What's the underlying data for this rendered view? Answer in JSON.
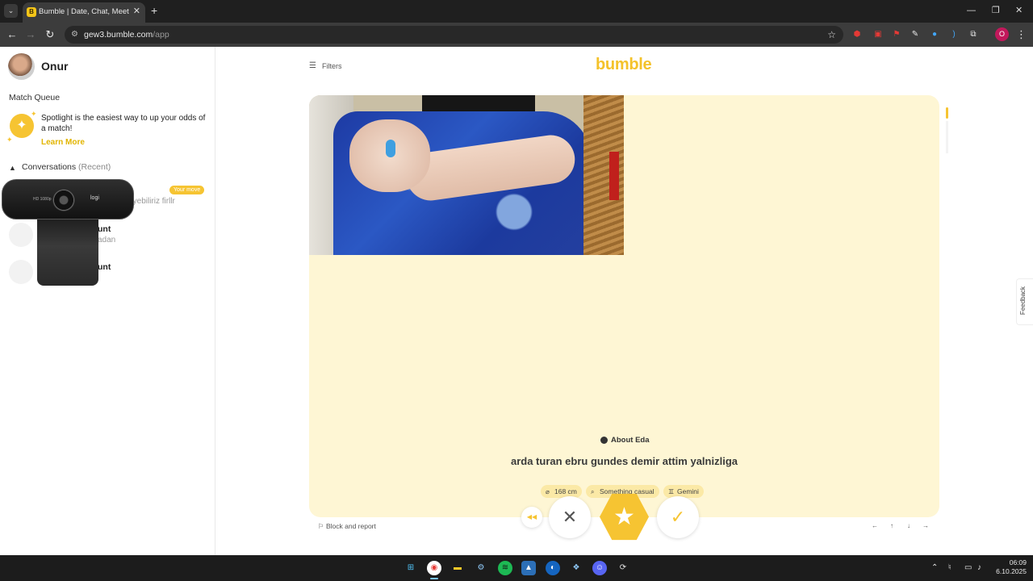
{
  "browser": {
    "tab_title": "Bumble | Date, Chat, Meet New",
    "tab_favicon": "B",
    "url_host": "gew3.bumble.com",
    "url_path": "/app",
    "profile_initial": "O"
  },
  "sidebar": {
    "user_name": "Onur",
    "match_queue_title": "Match Queue",
    "spotlight_text": "Spotlight is the easiest way to up your odds of a match!",
    "learn_more": "Learn More",
    "conversations_title": "Conversations",
    "conversations_filter": "(Recent)",
    "conversations": [
      {
        "badge": "Your move",
        "preview": "iliyebiliriz firllr"
      },
      {
        "name": "unt",
        "preview": "adan"
      },
      {
        "name": "unt"
      }
    ],
    "webcam_brand": "logi"
  },
  "main": {
    "filters_label": "Filters",
    "brand": "bumble",
    "about_title": "About Eda",
    "bio": "arda turan ebru gundes demir attim yalnizliga",
    "chips": [
      {
        "icon": "ruler-icon",
        "label": "168 cm"
      },
      {
        "icon": "search-icon",
        "label": "Something casual"
      },
      {
        "icon": "zodiac-icon",
        "label": "Gemini"
      }
    ],
    "block_report": "Block and report",
    "feedback": "Feedback",
    "keyboard_hints": [
      "←",
      "↑",
      "↓",
      "→"
    ]
  },
  "taskbar": {
    "time": "06:09",
    "date": "6.10.2025"
  },
  "colors": {
    "brand_yellow": "#f4c22a",
    "card_bg": "#fef6d4",
    "chip_bg": "#fbe9a6"
  }
}
